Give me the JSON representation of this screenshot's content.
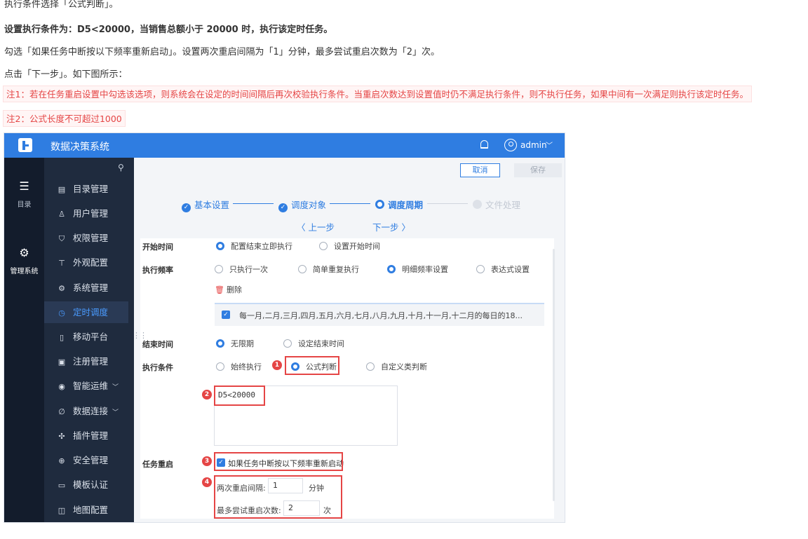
{
  "doc": {
    "line1": "执行条件选择「公式判断」。",
    "line2": "设置执行条件为：D5<20000，当销售总额小于 20000 时，执行该定时任务。",
    "line3": "勾选「如果任务中断按以下频率重新启动」。设置两次重启间隔为「1」分钟，最多尝试重启次数为「2」次。",
    "line4": "点击「下一步」。如下图所示：",
    "note1": "注1：若在任务重启设置中勾选该选项，则系统会在设定的时间间隔后再次校验执行条件。当重启次数达到设置值时仍不满足执行条件，则不执行任务，如果中间有一次满足则执行该定时任务。",
    "note2": "注2：公式长度不可超过1000"
  },
  "app": {
    "title": "数据决策系统",
    "user": "admin",
    "rail": [
      {
        "label": "目录",
        "icon": "list-icon"
      },
      {
        "label": "管理系统",
        "icon": "gear-icon",
        "active": true
      }
    ],
    "menu": [
      {
        "label": "目录管理",
        "icon": "catalog-icon"
      },
      {
        "label": "用户管理",
        "icon": "user-icon"
      },
      {
        "label": "权限管理",
        "icon": "shield-icon"
      },
      {
        "label": "外观配置",
        "icon": "appearance-icon"
      },
      {
        "label": "系统管理",
        "icon": "settings-icon"
      },
      {
        "label": "定时调度",
        "icon": "clock-icon",
        "active": true
      },
      {
        "label": "移动平台",
        "icon": "mobile-icon"
      },
      {
        "label": "注册管理",
        "icon": "register-icon"
      },
      {
        "label": "智能运维",
        "icon": "ops-icon",
        "expandable": true
      },
      {
        "label": "数据连接",
        "icon": "link-icon",
        "expandable": true
      },
      {
        "label": "插件管理",
        "icon": "plugin-icon"
      },
      {
        "label": "安全管理",
        "icon": "security-icon"
      },
      {
        "label": "模板认证",
        "icon": "template-icon"
      },
      {
        "label": "地图配置",
        "icon": "map-icon"
      }
    ],
    "toolbar": {
      "cancel": "取消",
      "save": "保存"
    },
    "steps": [
      "基本设置",
      "调度对象",
      "调度周期",
      "文件处理"
    ],
    "nav": {
      "prev": "〈 上一步",
      "next": "下一步 〉"
    },
    "form": {
      "start_time": {
        "label": "开始时间",
        "options": [
          "配置结束立即执行",
          "设置开始时间"
        ],
        "selected": 0
      },
      "frequency": {
        "label": "执行频率",
        "options": [
          "只执行一次",
          "简单重复执行",
          "明细频率设置",
          "表达式设置"
        ],
        "selected": 2
      },
      "delete": "删除",
      "freq_item": "每一月,二月,三月,四月,五月,六月,七月,八月,九月,十月,十一月,十二月的每日的18...",
      "end_time": {
        "label": "结束时间",
        "options": [
          "无限期",
          "设定结束时间"
        ],
        "selected": 0
      },
      "condition": {
        "label": "执行条件",
        "options": [
          "始终执行",
          "公式判断",
          "自定义类判断"
        ],
        "selected": 1
      },
      "formula": "D5<20000",
      "restart": {
        "label": "任务重启",
        "checkbox": "如果任务中断按以下频率重新启动",
        "interval_label": "两次重启间隔:",
        "interval_value": "1",
        "interval_unit": "分钟",
        "max_label": "最多尝试重启次数:",
        "max_value": "2",
        "max_unit": "次"
      }
    },
    "callouts": [
      "1",
      "2",
      "3",
      "4"
    ],
    "colors": {
      "topbar": "#2f7de1",
      "sidebar": "#1f2b3e",
      "rail": "#131c2c",
      "accent": "#2f7de1",
      "callout": "#e54545"
    }
  }
}
